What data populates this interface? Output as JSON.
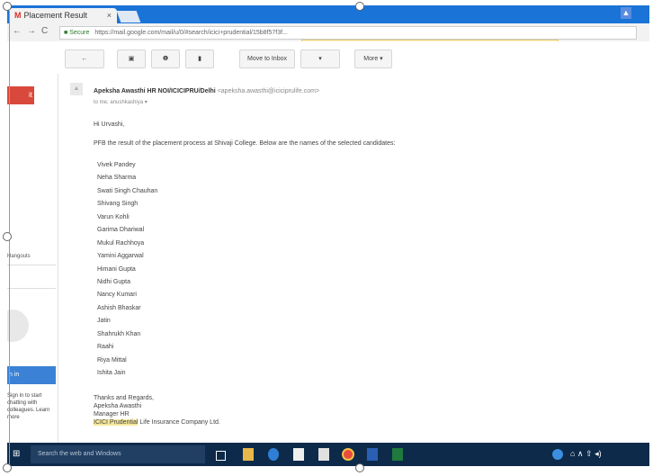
{
  "tab": {
    "title": "Placement Result",
    "gmail_mark": "M",
    "close": "×"
  },
  "window": {
    "profile": "▲"
  },
  "address": {
    "secure_label": "Secure",
    "url": "https://mail.google.com/mail/u/0/#search/icici+prudential/15b8f57f3f...",
    "back": "←",
    "forward": "→",
    "reload": "C"
  },
  "toolbar": {
    "back_label": "←",
    "archive_label": "▣",
    "spam_label": "❶",
    "delete_label": "▮",
    "move_inbox_label": "Move to Inbox",
    "labels_label": "▾",
    "more_label": "More ▾"
  },
  "leftnav": {
    "compose_label": "it",
    "contacts_label": "Hangouts",
    "signin_label": "n in",
    "signin_text": "Sign in to start chatting with colleagues. Learn more",
    "signin_link": "Learn more"
  },
  "message": {
    "sender_name": "Apeksha Awasthi  HR NOI/ICICIPRU/Delhi",
    "sender_email": "<apeksha.awasthi@iciciprulife.com>",
    "to": "to me, anushkashiya ▾",
    "greeting": "Hi Urvashi,",
    "intro": "PFB the result of the placement process at Shivaji College. Below are the names of the selected candidates:",
    "names": [
      "Vivek Pandey",
      "Neha Sharma",
      "Swati Singh Chauhan",
      "Shivang Singh",
      "Varun Kohli",
      "Garima Dhariwal",
      "Mukul Rachhoya",
      "Yamini Aggarwal",
      "Himani Gupta",
      "Nidhi Gupta",
      "Nancy Kumari",
      "Ashish Bhaskar",
      "Jatin",
      "Shahrukh Khan",
      "Raahi",
      "Riya Mittal",
      "Ishita Jain"
    ],
    "sign_off": "Thanks and Regards,",
    "sign_name": "Apeksha Awasthi",
    "sign_title": "Manager HR",
    "sign_company_hl": "ICICI Prudential",
    "sign_company_rest": " Life Insurance Company Ltd."
  },
  "taskbar": {
    "start": "⊞",
    "search_placeholder": "Search the web and Windows",
    "time_icons": "⌂ ∧ ⇧ ◂)"
  },
  "colors": {
    "chrome_blue": "#1a73d6",
    "compose_red": "#d9493b",
    "taskbar": "#0d2a4a",
    "signin_blue": "#3b82d6",
    "highlight": "#f5e79a"
  }
}
